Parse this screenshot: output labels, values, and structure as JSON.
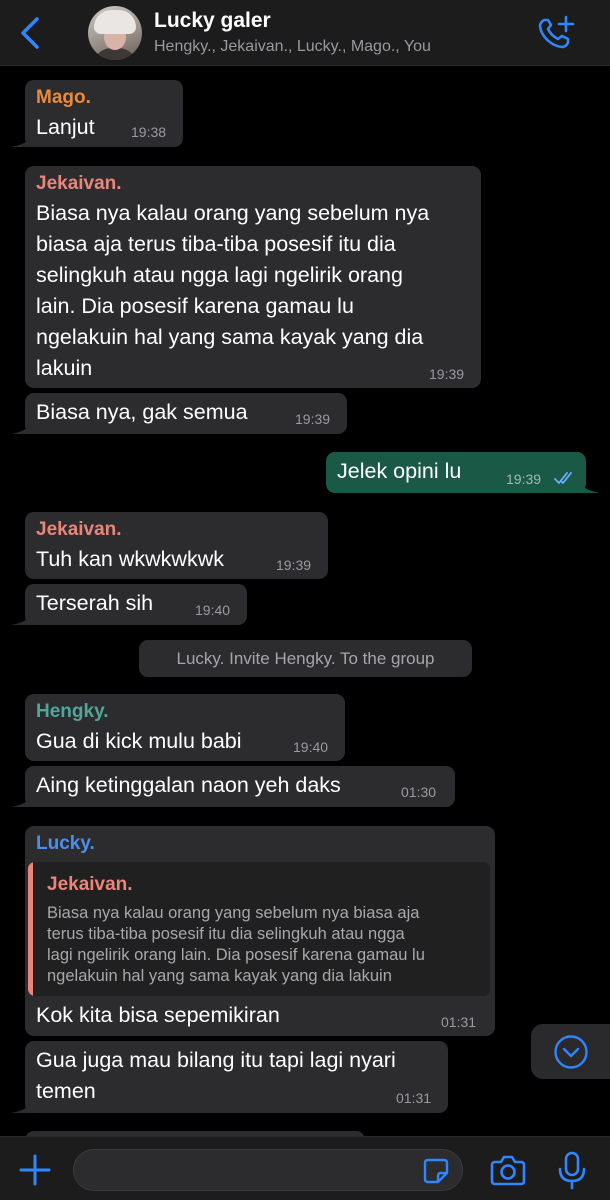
{
  "header": {
    "back_icon": "chevron-left-icon",
    "title": "Lucky galer",
    "subtitle": "Hengky., Jekaivan., Lucky., Mago., You",
    "call_icon": "phone-plus-icon"
  },
  "colors": {
    "accent": "#2f86ff",
    "outgoing_bubble": "#195946",
    "incoming_bubble": "#2c2c2e",
    "mago": "#e98a3c",
    "jekaivan": "#e9857a",
    "hengky": "#4fa79a",
    "lucky": "#4a8ff0"
  },
  "messages": [
    {
      "sender": "Mago.",
      "text": "Lanjut",
      "time": "19:38"
    },
    {
      "sender": "Jekaivan.",
      "lines": [
        "Biasa nya kalau orang yang sebelum nya",
        "biasa aja terus tiba-tiba posesif itu dia",
        "selingkuh atau ngga lagi ngelirik orang",
        "lain. Dia posesif karena gamau lu",
        "ngelakuin hal yang sama kayak yang dia",
        "lakuin"
      ],
      "time": "19:39"
    },
    {
      "text": "Biasa nya, gak semua",
      "time": "19:39"
    },
    {
      "text": "Jelek opini lu",
      "time": "19:39",
      "status": "read"
    },
    {
      "sender": "Jekaivan.",
      "text": "Tuh kan wkwkwkwk",
      "time": "19:39"
    },
    {
      "text": "Terserah sih",
      "time": "19:40"
    },
    {
      "sender": "Hengky.",
      "text": "Gua di kick mulu babi",
      "time": "19:40"
    },
    {
      "text": "Aing ketinggalan naon yeh daks",
      "time": "01:30"
    },
    {
      "sender": "Lucky.",
      "quote": {
        "sender": "Jekaivan.",
        "lines": [
          "Biasa nya kalau orang yang sebelum nya biasa aja",
          "terus tiba-tiba posesif itu dia selingkuh atau ngga",
          "lagi ngelirik orang lain. Dia posesif karena gamau lu",
          "ngelakuin hal yang sama kayak yang dia lakuin"
        ]
      },
      "text": "Kok kita bisa sepemikiran",
      "time": "01:31"
    },
    {
      "lines": [
        "Gua juga mau bilang itu tapi lagi nyari",
        "temen"
      ],
      "time": "01:31"
    }
  ],
  "system_message": "Lucky. Invite Hengky. To the group",
  "input_bar": {
    "placeholder": "",
    "icons": [
      "plus-icon",
      "sticker-icon",
      "camera-icon",
      "microphone-icon"
    ]
  },
  "scroll_down_icon": "chevron-down-circle-icon"
}
